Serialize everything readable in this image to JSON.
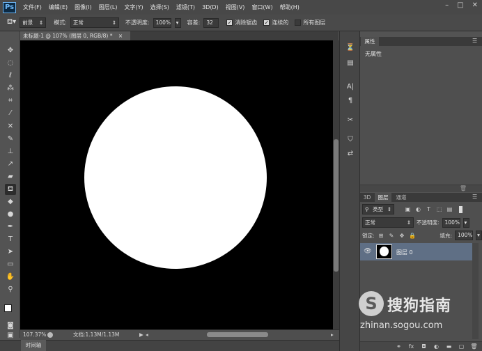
{
  "app": {
    "logo": "Ps"
  },
  "menu": [
    "文件(F)",
    "编辑(E)",
    "图像(I)",
    "图层(L)",
    "文字(Y)",
    "选择(S)",
    "滤镜(T)",
    "3D(D)",
    "视图(V)",
    "窗口(W)",
    "帮助(H)"
  ],
  "window_controls": {
    "minimize": "–",
    "maximize": "□",
    "close": "✕"
  },
  "options": {
    "tool_icon": "paint-bucket-icon",
    "fill_source": "前景",
    "mode_label": "模式:",
    "mode_value": "正常",
    "opacity_label": "不透明度:",
    "opacity_value": "100%",
    "tolerance_label": "容差:",
    "tolerance_value": "32",
    "antialias_label": "消除锯齿",
    "contiguous_label": "连续的",
    "all_layers_label": "所有图层"
  },
  "document": {
    "tab_title": "未标题-1 @ 107% (图层 0, RGB/8) *",
    "close": "×",
    "zoom": "107.37%",
    "doc_info": "文档:1.13M/1.13M"
  },
  "timeline": {
    "label": "时间轴"
  },
  "properties": {
    "tab": "属性",
    "body": "无属性"
  },
  "layers": {
    "tabs": [
      "3D",
      "图层",
      "通道"
    ],
    "filter_label": "类型",
    "blend_mode": "正常",
    "opacity_label": "不透明度:",
    "opacity_value": "100%",
    "lock_label": "锁定:",
    "fill_label": "填充:",
    "fill_value": "100%",
    "items": [
      {
        "name": "图层 0",
        "visible": true
      }
    ]
  },
  "watermark": {
    "logo": "S",
    "title": "搜狗指南",
    "url": "zhinan.sogou.com"
  },
  "colors": {
    "accent": "#6fb7f5",
    "selected_layer": "#5f6f85",
    "canvas": "#000000",
    "shape": "#ffffff"
  }
}
